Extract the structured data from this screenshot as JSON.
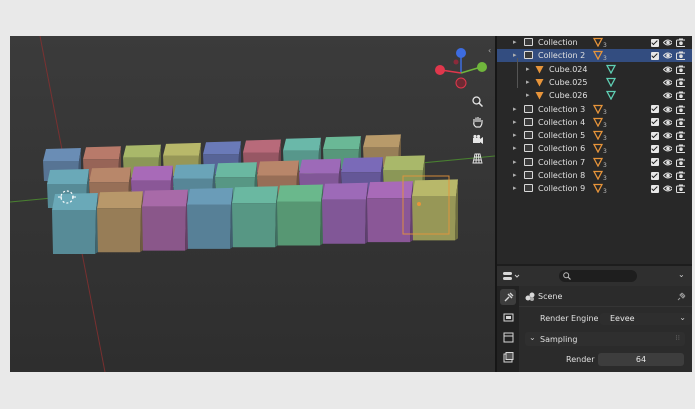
{
  "outliner": {
    "rows": [
      {
        "label": "Collection",
        "type": "collection",
        "sub": "3"
      },
      {
        "label": "Collection 2",
        "type": "collection",
        "sub": "3",
        "selected": true
      },
      {
        "label": "Cube.024",
        "type": "mesh"
      },
      {
        "label": "Cube.025",
        "type": "mesh"
      },
      {
        "label": "Cube.026",
        "type": "mesh"
      },
      {
        "label": "Collection 3",
        "type": "collection",
        "sub": "3"
      },
      {
        "label": "Collection 4",
        "type": "collection",
        "sub": "3"
      },
      {
        "label": "Collection 5",
        "type": "collection",
        "sub": "3"
      },
      {
        "label": "Collection 6",
        "type": "collection",
        "sub": "3"
      },
      {
        "label": "Collection 7",
        "type": "collection",
        "sub": "3"
      },
      {
        "label": "Collection 8",
        "type": "collection",
        "sub": "3"
      },
      {
        "label": "Collection 9",
        "type": "collection",
        "sub": "3"
      }
    ]
  },
  "properties": {
    "search_placeholder": "",
    "scene_label": "Scene",
    "render_engine_label": "Render Engine",
    "render_engine_value": "Eevee",
    "sampling_label": "Sampling",
    "render_label": "Render",
    "render_value": "64"
  },
  "viewport": {
    "gizmo_labels": {
      "x": "X",
      "y": "Y",
      "z": "Z"
    },
    "tool_icons": [
      "zoom-icon",
      "hand-pan-icon",
      "camera-icon",
      "grid-icon"
    ]
  },
  "colors": {
    "selection": "#334d80",
    "accent_orange": "#e7943a",
    "mesh_green": "#5fcfb4",
    "axis_x": "#e0374c",
    "axis_y": "#70b63c",
    "axis_z": "#3d6ce0"
  }
}
